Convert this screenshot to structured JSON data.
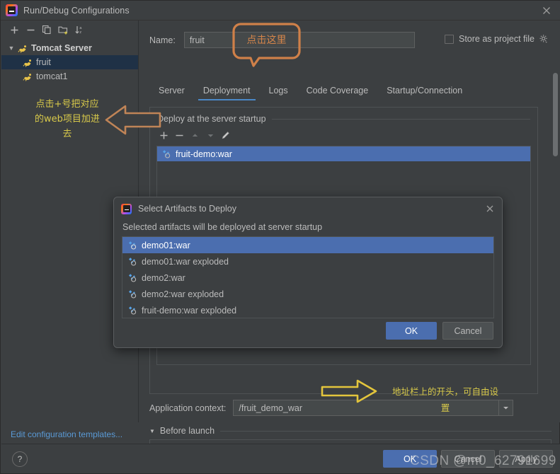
{
  "window": {
    "title": "Run/Debug Configurations",
    "logo_icon": "intellij-idea-logo",
    "close_icon": "close-icon"
  },
  "sidebar": {
    "toolbar": [
      {
        "name": "add-configuration-button",
        "icon": "plus-icon"
      },
      {
        "name": "remove-configuration-button",
        "icon": "minus-icon"
      },
      {
        "name": "copy-configuration-button",
        "icon": "copy-icon"
      },
      {
        "name": "save-configuration-button",
        "icon": "folder-add-icon"
      },
      {
        "name": "sort-configurations-button",
        "icon": "sort-alpha-icon"
      }
    ],
    "tree": {
      "group_label": "Tomcat Server",
      "group_icon": "tomcat-icon",
      "expand_icon": "chevron-down-icon",
      "children": [
        {
          "label": "fruit",
          "icon": "tomcat-icon",
          "selected": true
        },
        {
          "label": "tomcat1",
          "icon": "tomcat-icon",
          "selected": false
        }
      ]
    },
    "edit_templates_link": "Edit configuration templates..."
  },
  "main": {
    "name_label": "Name:",
    "name_value": "fruit",
    "name_placeholder": "",
    "store_as_project_file_label": "Store as project file",
    "store_as_project_file_checked": false,
    "gear_icon": "gear-icon",
    "tabs": [
      {
        "label": "Server",
        "active": false
      },
      {
        "label": "Deployment",
        "active": true
      },
      {
        "label": "Logs",
        "active": false
      },
      {
        "label": "Code Coverage",
        "active": false
      },
      {
        "label": "Startup/Connection",
        "active": false
      }
    ],
    "deployment": {
      "group_title": "Deploy at the server startup",
      "toolbar": [
        {
          "name": "add-artifact-button",
          "icon": "plus-icon"
        },
        {
          "name": "remove-artifact-button",
          "icon": "minus-icon"
        },
        {
          "name": "move-up-button",
          "icon": "arrow-up-icon"
        },
        {
          "name": "move-down-button",
          "icon": "arrow-down-icon"
        },
        {
          "name": "edit-artifact-button",
          "icon": "pencil-icon"
        }
      ],
      "items": [
        {
          "label": "fruit-demo:war",
          "icon": "artifact-icon",
          "selected": true
        }
      ]
    },
    "application_context_label": "Application context:",
    "application_context_value": "/fruit_demo_war",
    "application_context_dropdown_icon": "chevron-down-icon",
    "before_launch_label": "Before launch",
    "before_launch_collapse_icon": "triangle-down-icon"
  },
  "modal": {
    "title": "Select Artifacts to Deploy",
    "logo_icon": "intellij-idea-logo",
    "close_icon": "close-icon",
    "subtitle": "Selected artifacts will be deployed at server startup",
    "items": [
      {
        "label": "demo01:war",
        "icon": "artifact-icon",
        "selected": true
      },
      {
        "label": "demo01:war exploded",
        "icon": "artifact-icon",
        "selected": false
      },
      {
        "label": "demo2:war",
        "icon": "artifact-icon",
        "selected": false
      },
      {
        "label": "demo2:war exploded",
        "icon": "artifact-icon",
        "selected": false
      },
      {
        "label": "fruit-demo:war exploded",
        "icon": "artifact-icon",
        "selected": false
      }
    ],
    "ok_label": "OK",
    "cancel_label": "Cancel"
  },
  "footer": {
    "help_label": "?",
    "help_icon": "question-mark-icon",
    "ok_label": "OK",
    "cancel_label": "Cancel",
    "apply_label": "Apply"
  },
  "annotations": {
    "callout_text": "点击这里",
    "left_text": "点击+号把对应的web项目加进去",
    "left_arrow_icon": "arrow-left-annotation",
    "right_text": "地址栏上的开头，可自由设置",
    "right_arrow_icon": "arrow-right-annotation",
    "watermark": "CSDN @m0_62791699"
  },
  "colors": {
    "accent_blue": "#4b6eaf",
    "tab_underline": "#4a88c7",
    "panel_bg": "#3c3f41",
    "annotation_orange": "#d5854a",
    "annotation_yellow": "#d8c94a",
    "link_blue": "#5a9ad6"
  }
}
